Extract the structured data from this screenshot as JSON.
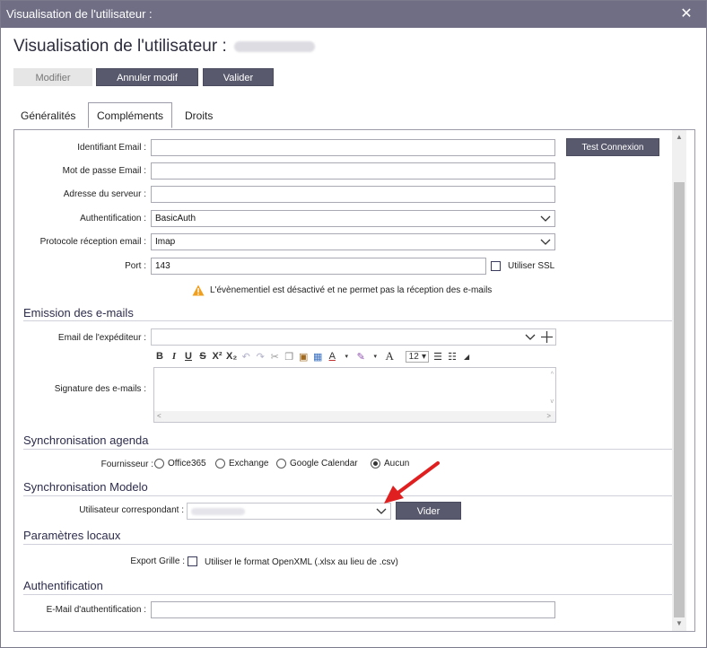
{
  "window": {
    "title": "Visualisation de l'utilisateur :",
    "close_glyph": "✕"
  },
  "header": {
    "title": "Visualisation de l'utilisateur :"
  },
  "actions": {
    "modifier": "Modifier",
    "annuler": "Annuler modif",
    "valider": "Valider"
  },
  "tabs": [
    {
      "label": "Généralités",
      "active": false
    },
    {
      "label": "Compléments",
      "active": true
    },
    {
      "label": "Droits",
      "active": false
    }
  ],
  "email_settings": {
    "identifiant_label": "Identifiant Email :",
    "identifiant_value": "",
    "password_label": "Mot de passe Email :",
    "password_value": "",
    "server_label": "Adresse du serveur :",
    "server_value": "",
    "auth_label": "Authentification :",
    "auth_value": "BasicAuth",
    "protocol_label": "Protocole réception email :",
    "protocol_value": "Imap",
    "port_label": "Port :",
    "port_value": "143",
    "ssl_label": "Utiliser SSL",
    "test_button": "Test Connexion",
    "warning_text": "L'évènementiel est désactivé et ne permet pas la réception des e-mails"
  },
  "emission": {
    "section_title": "Emission des e-mails",
    "sender_label": "Email de l'expéditeur :",
    "signature_label": "Signature des e-mails :",
    "font_size": "12"
  },
  "agenda": {
    "section_title": "Synchronisation agenda",
    "provider_label": "Fournisseur :",
    "options": [
      "Office365",
      "Exchange",
      "Google Calendar",
      "Aucun"
    ],
    "selected": "Aucun"
  },
  "modelo": {
    "section_title": "Synchronisation Modelo",
    "user_label": "Utilisateur correspondant :",
    "clear_button": "Vider"
  },
  "local": {
    "section_title": "Paramètres locaux",
    "export_label": "Export Grille :",
    "openxml_label": "Utiliser le format OpenXML (.xlsx au lieu de .csv)"
  },
  "auth_section": {
    "section_title": "Authentification",
    "email_label": "E-Mail d'authentification :",
    "email_value": ""
  },
  "colors": {
    "titlebar": "#6f6e85",
    "button": "#58596d",
    "arrow": "#e02020",
    "warning": "#f0a020"
  },
  "icons": [
    "close-icon",
    "chevron-down-icon",
    "plus-icon",
    "warning-icon",
    "arrow-annotation"
  ]
}
